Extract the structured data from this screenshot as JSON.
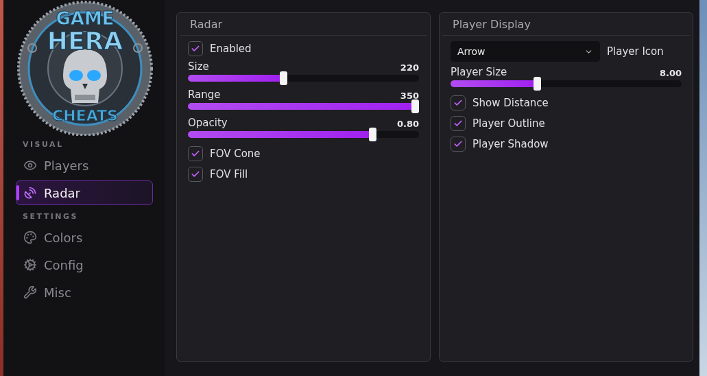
{
  "sidebar": {
    "logo": {
      "top": "GAME",
      "middle": "HERA",
      "bottom": "CHEATS"
    },
    "sections": [
      {
        "title": "VISUAL",
        "items": [
          {
            "label": "Players",
            "selected": false
          },
          {
            "label": "Radar",
            "selected": true
          }
        ]
      },
      {
        "title": "SETTINGS",
        "items": [
          {
            "label": "Colors",
            "selected": false
          },
          {
            "label": "Config",
            "selected": false
          },
          {
            "label": "Misc",
            "selected": false
          }
        ]
      }
    ]
  },
  "panels": [
    {
      "title": "Radar",
      "controls": [
        {
          "kind": "checkbox",
          "label": "Enabled",
          "checked": true
        },
        {
          "kind": "slider",
          "label": "Size",
          "reading": "220",
          "level": 0.41
        },
        {
          "kind": "slider",
          "label": "Range",
          "reading": "350",
          "level": 1
        },
        {
          "kind": "slider",
          "label": "Opacity",
          "reading": "0.80",
          "level": 0.81
        },
        {
          "kind": "checkbox",
          "label": "FOV Cone",
          "checked": true
        },
        {
          "kind": "checkbox",
          "label": "FOV Fill",
          "checked": true
        }
      ]
    },
    {
      "title": "Player Display",
      "controls": [
        {
          "kind": "dropdown",
          "selected_option": "Arrow",
          "label": "Player Icon"
        },
        {
          "kind": "slider",
          "label": "Player Size",
          "reading": "8.00",
          "level": 0.37
        },
        {
          "kind": "checkbox",
          "label": "Show Distance",
          "checked": true
        },
        {
          "kind": "checkbox",
          "label": "Player Outline",
          "checked": true
        },
        {
          "kind": "checkbox",
          "label": "Player Shadow",
          "checked": true
        }
      ]
    }
  ]
}
